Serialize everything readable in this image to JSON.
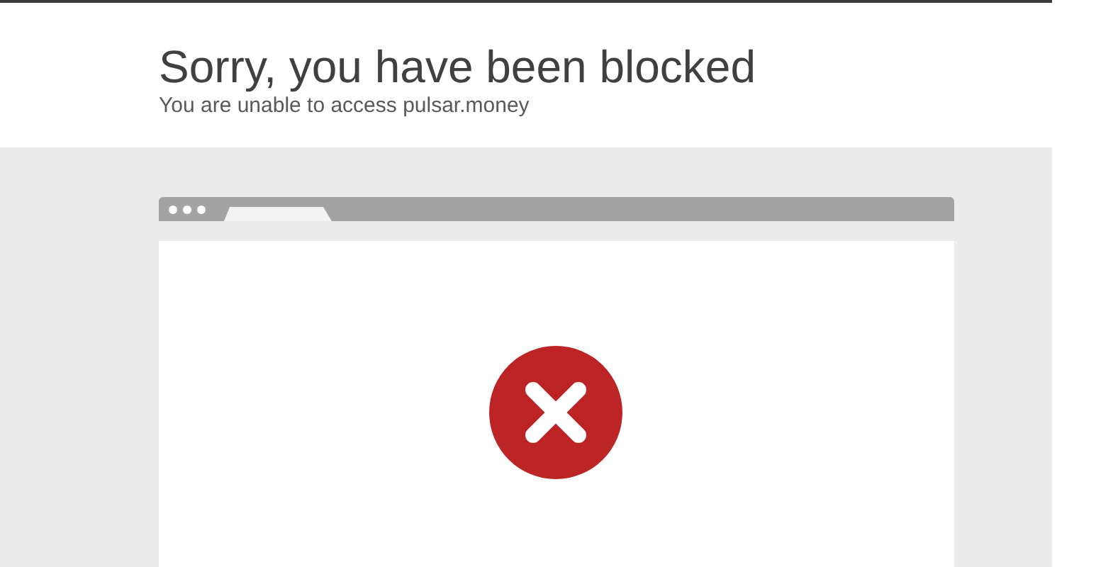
{
  "header": {
    "title": "Sorry, you have been blocked",
    "subtitle": "You are unable to access pulsar.money"
  }
}
